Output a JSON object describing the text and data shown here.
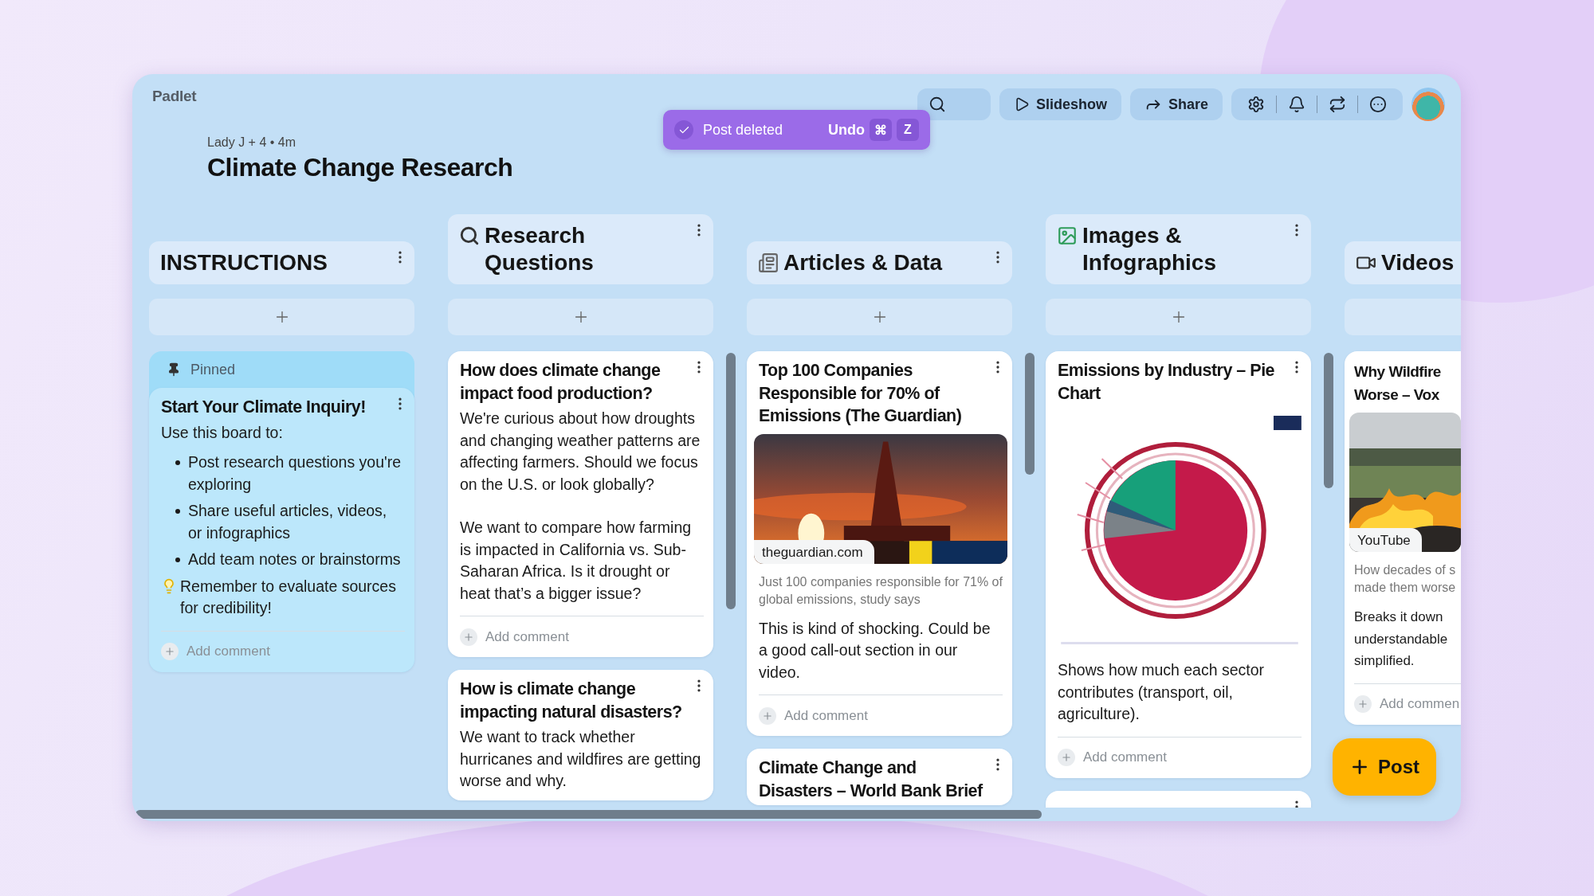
{
  "app": {
    "logo": "Padlet"
  },
  "board": {
    "meta": "Lady J + 4 • 4m",
    "title": "Climate Change Research"
  },
  "toolbar": {
    "buttons": [
      {
        "kind": "slideshow",
        "label": "Slideshow"
      },
      {
        "kind": "share",
        "label": "Share"
      }
    ]
  },
  "toast": {
    "message": "Post deleted",
    "action": "Undo",
    "keys": [
      "⌘",
      "Z"
    ]
  },
  "columns": [
    {
      "title": "INSTRUCTIONS",
      "posts": [
        {
          "kind": "note",
          "pinned": true,
          "pin_label": "Pinned",
          "title": "Start Your Climate Inquiry!",
          "body": [
            "Use this board to:"
          ],
          "bullets": [
            "Post research questions you're exploring",
            "Share useful articles, videos, or infographics",
            "Add team notes or brainstorms"
          ],
          "tip": "Remember to evaluate sources for credibility!",
          "comment": "Add comment"
        }
      ]
    },
    {
      "title": "Research Questions",
      "posts": [
        {
          "kind": "note",
          "pinned": false,
          "title": "How does climate change impact food production?",
          "body": [
            "We're curious about how droughts and changing weather patterns are affecting farmers. Should we focus on the U.S. or look globally?",
            "We want to compare how farming is impacted in California vs. Sub-Saharan Africa. Is it drought or heat that’s a bigger issue?"
          ],
          "comment": "Add comment"
        },
        {
          "kind": "note",
          "pinned": false,
          "title": "How is climate change impacting natural disasters?",
          "body": [
            "We want to track whether hurricanes and wildfires are getting worse and why."
          ]
        }
      ]
    },
    {
      "title": "Articles & Data",
      "posts": [
        {
          "kind": "link",
          "pinned": false,
          "title": "Top 100 Companies Responsible for 70% of Emissions (The Guardian)",
          "source": "theguardian.com",
          "description": "Just 100 companies responsible for 71% of global emissions, study says",
          "body": [
            "This is kind of shocking. Could be a good call-out section in our video."
          ],
          "comment": "Add comment"
        },
        {
          "kind": "note",
          "pinned": false,
          "title": "Climate Change and Disasters – World Bank Brief"
        }
      ]
    },
    {
      "title": "Images & Infographics",
      "posts": [
        {
          "pinned": false,
          "title": "Emissions by Industry – Pie Chart",
          "body": [
            "Shows how much each sector contributes (transport, oil, agriculture)."
          ],
          "comment": "Add comment"
        },
        {
          "kind": "blank",
          "pinned": false
        }
      ]
    },
    {
      "title": "Videos",
      "posts": [
        {
          "kind": "video",
          "pinned": false,
          "title": "Why Wildfire\nWorse – Vox",
          "source": "YouTube",
          "description": "How decades of s\nmade them worse",
          "body": [
            "Breaks it down\nunderstandable\nsimplified."
          ],
          "comment": "Add commen"
        }
      ]
    }
  ],
  "post_button": {
    "label": "Post"
  }
}
